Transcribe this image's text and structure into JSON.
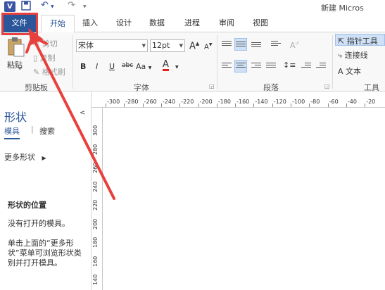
{
  "titlebar": {
    "app_icon": "V",
    "save_icon": "save-icon",
    "undo_glyph": "↶",
    "redo_glyph": "↷",
    "doc_title": "新建 Micros"
  },
  "tabs": {
    "file": "文件",
    "home": "开始",
    "insert": "插入",
    "design": "设计",
    "data": "数据",
    "process": "进程",
    "review": "审阅",
    "view": "视图"
  },
  "ribbon": {
    "clipboard": {
      "paste": "粘贴",
      "cut": "剪切",
      "copy": "复制",
      "format_painter": "格式刷",
      "label": "剪贴板"
    },
    "font": {
      "font_name": "宋体",
      "font_size": "12pt",
      "grow": "A",
      "shrink": "A",
      "bold": "B",
      "italic": "I",
      "underline": "U",
      "strike": "abc",
      "case": "Aa",
      "color": "A",
      "label": "字体"
    },
    "paragraph": {
      "label": "段落"
    },
    "tools": {
      "pointer": "指针工具",
      "connector": "连接线",
      "text": "文本",
      "label": "工具"
    }
  },
  "shapes_panel": {
    "title": "形状",
    "tab_stencils": "模具",
    "tab_search": "搜索",
    "more_shapes": "更多形状",
    "heading": "形状的位置",
    "no_stencils": "没有打开的模具。",
    "help_text": "单击上面的“更多形状”菜单可浏览形状类别并打开模具。"
  },
  "ruler": {
    "h_labels": [
      "-300",
      "-280",
      "-260",
      "-240",
      "-220",
      "-200",
      "-180",
      "-160",
      "-140",
      "-120",
      "-100",
      "-80",
      "-60",
      "-40",
      "-20"
    ],
    "v_labels": [
      "300",
      "280",
      "260",
      "240",
      "220",
      "200",
      "180",
      "160",
      "140"
    ]
  },
  "colors": {
    "accent": "#2b579a",
    "file_tab": "#2b579a",
    "annotation": "#e8403d"
  }
}
